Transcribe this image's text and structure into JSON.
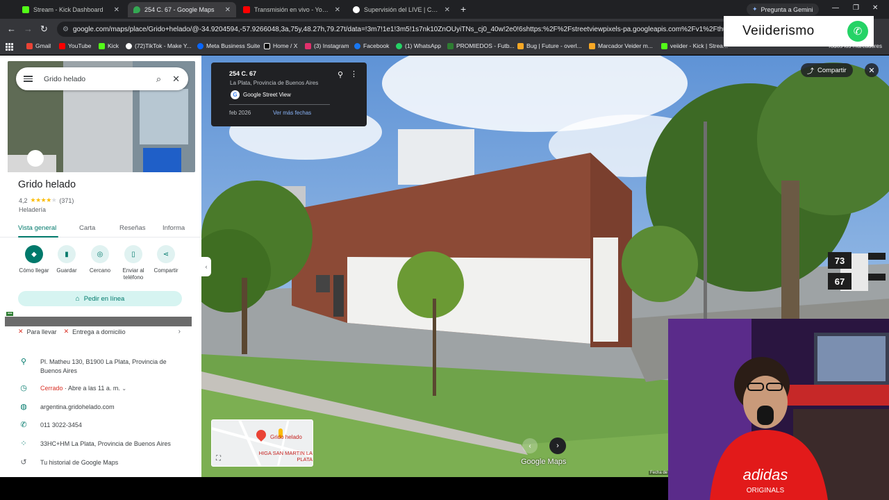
{
  "browser": {
    "tabs": [
      {
        "label": "Stream - Kick Dashboard",
        "color": "#53fc18"
      },
      {
        "label": "254 C. 67 - Google Maps",
        "color": "#34a853",
        "active": true
      },
      {
        "label": "Transmisión en vivo - YouTube",
        "color": "#ff0000"
      },
      {
        "label": "Supervisión del LIVE | Centro LI...",
        "color": "#ffffff"
      }
    ],
    "gemini_label": "Pregunta a Gemini",
    "url": "google.com/maps/place/Grido+helado/@-34.9204594,-57.9266048,3a,75y,48.27h,79.27t/data=!3m7!1e1!3m5!1s7nk10ZnOUyiTNs_cj0_40w!2e0!6shttps:%2F%2Fstreetviewpixels-pa.googleapis.com%2Fv1%2Fthumbnail%3Fcb_client",
    "bookmarks": [
      {
        "label": "Gmail",
        "color": "#ea4335"
      },
      {
        "label": "YouTube",
        "color": "#ff0000"
      },
      {
        "label": "Kick",
        "color": "#53fc18"
      },
      {
        "label": "(72)TikTok - Make Y...",
        "color": "#ffffff"
      },
      {
        "label": "Meta Business Suite",
        "color": "#0866ff"
      },
      {
        "label": "Home / X",
        "color": "#ffffff"
      },
      {
        "label": "(3) Instagram",
        "color": "#e1306c"
      },
      {
        "label": "Facebook",
        "color": "#1877f2"
      },
      {
        "label": "(1) WhatsApp",
        "color": "#25d366"
      },
      {
        "label": "PROMIEDOS - Futb...",
        "color": "#2e7d32"
      },
      {
        "label": "Bug | Future - overl...",
        "color": "#f9a825"
      },
      {
        "label": "Marcador Veider m...",
        "color": "#f9a825"
      },
      {
        "label": "veiider - Kick | Strea...",
        "color": "#53fc18"
      }
    ],
    "all_bookmarks": "Todos los marcadores"
  },
  "maps": {
    "search_value": "Grido helado",
    "place": {
      "name": "Grido helado",
      "rating": "4,2",
      "reviews": "(371)",
      "category": "Heladería"
    },
    "tabs": [
      "Vista general",
      "Carta",
      "Reseñas",
      "Informa"
    ],
    "actions": [
      {
        "label": "Cómo llegar",
        "icon": "directions-icon"
      },
      {
        "label": "Guardar",
        "icon": "bookmark-icon"
      },
      {
        "label": "Cercano",
        "icon": "nearby-icon"
      },
      {
        "label": "Enviar al teléfono",
        "icon": "phone-send-icon"
      },
      {
        "label": "Compartir",
        "icon": "share-icon"
      }
    ],
    "order_button": "Pedir en línea",
    "delivery": {
      "option1": "Para llevar",
      "option2": "Entrega a domicilio"
    },
    "info": {
      "address": "Pl. Matheu 130, B1900 La Plata, Provincia de Buenos Aires",
      "status_closed": "Cerrado",
      "status_opens": " · Abre a las 11 a. m.",
      "website": "argentina.gridohelado.com",
      "phone": "011 3022-3454",
      "plus_code": "33HC+HM La Plata, Provincia de Buenos Aires",
      "history": "Tu historial de Google Maps"
    }
  },
  "streetview": {
    "title": "254 C. 67",
    "subtitle": "La Plata, Provincia de Buenos Aires",
    "source": "Google Street View",
    "date": "feb 2026",
    "more_dates": "Ver más fechas",
    "share": "Compartir",
    "minimap_label": "Grido helado",
    "minimap_hospital": "HIGA SAN MARTIN LA PLATA",
    "logo": "Google Maps",
    "date_footer": "Fecha de",
    "signs": [
      "73",
      "67"
    ]
  },
  "overlay": {
    "brand": "Veiiderismo"
  }
}
